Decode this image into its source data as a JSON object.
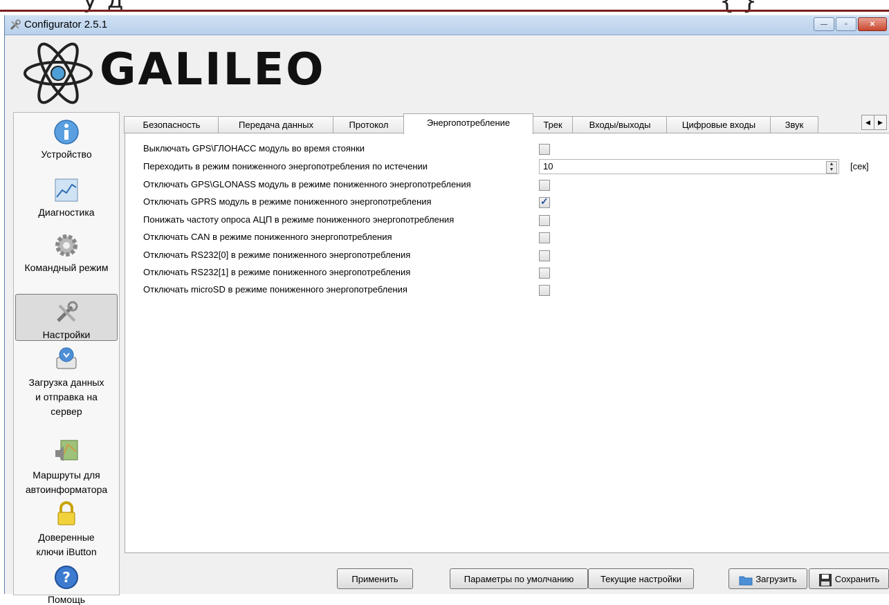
{
  "doc_fragment": {
    "text": "у  д",
    "brace": "{  }"
  },
  "window": {
    "title": "Configurator 2.5.1"
  },
  "logo": {
    "text": "GALILEO"
  },
  "sidebar": {
    "items": [
      {
        "label": "Устройство",
        "icon": "info-icon"
      },
      {
        "label": "Диагностика",
        "icon": "chart-icon"
      },
      {
        "label": "Командный режим",
        "icon": "gear-icon"
      },
      {
        "label": "Настройки",
        "icon": "tools-icon"
      },
      {
        "label": "Загрузка данных и отправка на сервер",
        "icon": "download-icon"
      },
      {
        "label": "Маршруты для автоинформатора",
        "icon": "map-speaker-icon"
      },
      {
        "label": "Доверенные ключи iButton",
        "icon": "lock-icon"
      },
      {
        "label": "Помощь",
        "icon": "help-icon"
      }
    ]
  },
  "tabs": [
    "Безопасность",
    "Передача данных",
    "Протокол",
    "Энергопотребление",
    "Трек",
    "Входы/выходы",
    "Цифровые входы",
    "Звук"
  ],
  "active_tab": "Энергопотребление",
  "settings": [
    {
      "label": "Выключать GPS\\ГЛОНАСС модуль во время стоянки",
      "type": "checkbox",
      "checked": false
    },
    {
      "label": "Переходить в режим пониженного энергопотребления по истечении",
      "type": "spin",
      "value": "10",
      "unit": "[сек]"
    },
    {
      "label": "Отключать GPS\\GLONASS модуль в режиме пониженного энергопотребления",
      "type": "checkbox",
      "checked": false
    },
    {
      "label": "Отключать GPRS модуль в режиме пониженного энергопотребления",
      "type": "checkbox",
      "checked": true
    },
    {
      "label": "Понижать частоту опроса АЦП в режиме пониженного энергопотребления",
      "type": "checkbox",
      "checked": false
    },
    {
      "label": "Отключать CAN в режиме пониженного энергопотребления",
      "type": "checkbox",
      "checked": false
    },
    {
      "label": "Отключать RS232[0] в режиме пониженного энергопотребления",
      "type": "checkbox",
      "checked": false
    },
    {
      "label": "Отключать RS232[1] в режиме пониженного энергопотребления",
      "type": "checkbox",
      "checked": false
    },
    {
      "label": "Отключать microSD в режиме пониженного энергопотребления",
      "type": "checkbox",
      "checked": false
    }
  ],
  "buttons": {
    "apply": "Применить",
    "defaults": "Параметры по умолчанию",
    "current": "Текущие настройки",
    "load": "Загрузить",
    "save": "Сохранить"
  },
  "colors": {
    "accent": "#2b4fa0",
    "titlebar": "#cfe0f3",
    "close": "#c9472f"
  }
}
